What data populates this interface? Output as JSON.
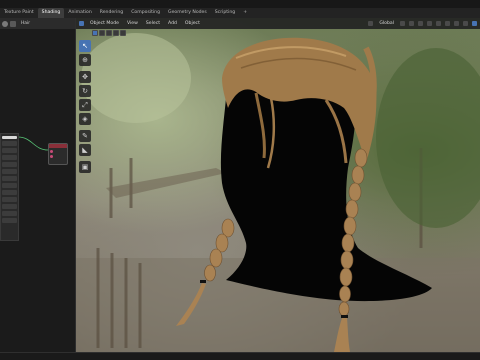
{
  "workspace_tabs": [
    {
      "label": "Texture Paint",
      "active": false
    },
    {
      "label": "Shading",
      "active": true
    },
    {
      "label": "Animation",
      "active": false
    },
    {
      "label": "Rendering",
      "active": false
    },
    {
      "label": "Compositing",
      "active": false
    },
    {
      "label": "Geometry Nodes",
      "active": false
    },
    {
      "label": "Scripting",
      "active": false
    },
    {
      "label": "+",
      "active": false
    }
  ],
  "left_panel": {
    "object_name": "Hair"
  },
  "viewport_header": {
    "mode": "Object Mode",
    "menu": [
      "View",
      "Select",
      "Add",
      "Object"
    ],
    "transform_orientation": "Global"
  },
  "toolbar": {
    "tools": [
      "select-box-icon",
      "cursor-icon",
      "move-icon",
      "rotate-icon",
      "scale-icon",
      "transform-icon",
      "annotate-icon",
      "measure-icon",
      "add-cube-icon"
    ]
  },
  "colors": {
    "accent": "#4773b3",
    "active_tab": "#3d3d3d",
    "hair": "#a07a4a",
    "node_header": "#8a2f39"
  }
}
